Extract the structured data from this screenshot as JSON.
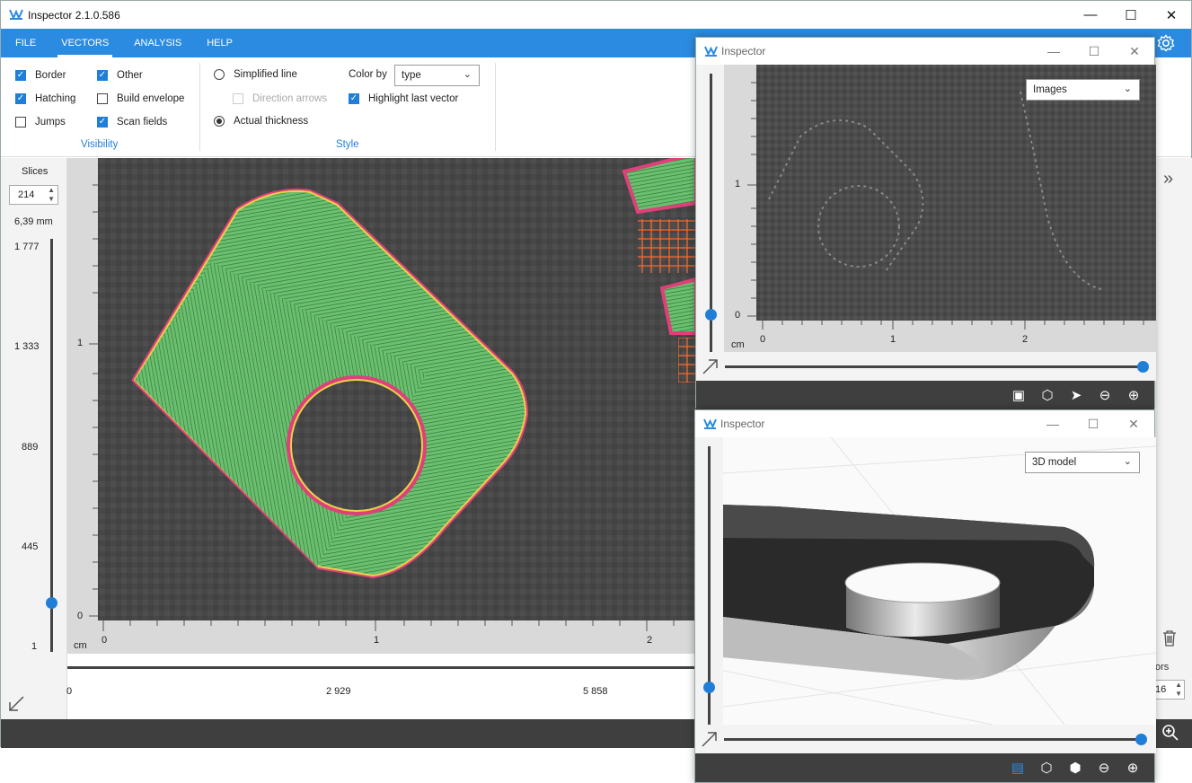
{
  "app": {
    "title": "Inspector 2.1.0.586"
  },
  "menu": {
    "items": [
      "FILE",
      "VECTORS",
      "ANALYSIS",
      "HELP"
    ],
    "active": "VECTORS"
  },
  "visibility": {
    "group_label": "Visibility",
    "border": {
      "label": "Border",
      "checked": true
    },
    "other": {
      "label": "Other",
      "checked": true
    },
    "hatching": {
      "label": "Hatching",
      "checked": true
    },
    "build_envelope": {
      "label": "Build envelope",
      "checked": false
    },
    "jumps": {
      "label": "Jumps",
      "checked": false
    },
    "scan_fields": {
      "label": "Scan fields",
      "checked": true
    }
  },
  "style": {
    "group_label": "Style",
    "simplified_line": {
      "label": "Simplified line",
      "selected": false
    },
    "direction_arrows": {
      "label": "Direction arrows",
      "enabled": false
    },
    "actual_thickness": {
      "label": "Actual thickness",
      "selected": true
    },
    "color_by_label": "Color by",
    "color_by_value": "type",
    "highlight_last_vector": {
      "label": "Highlight last vector",
      "checked": true
    }
  },
  "slices": {
    "label": "Slices",
    "value": "214",
    "height": "6,39 mm",
    "ticks": [
      "1 777",
      "1 333",
      "889",
      "445",
      "1"
    ],
    "position_fraction": 0.12
  },
  "main_view": {
    "y_ticks": [
      "1",
      "0"
    ],
    "x_ticks": [
      "0",
      "1",
      "2"
    ],
    "unit": "cm",
    "vector_axis_ticks": [
      "0",
      "2 929",
      "5 858"
    ]
  },
  "right_panel": {
    "partial_label": "ors",
    "partial_value": "16"
  },
  "window_images": {
    "title": "Inspector",
    "dropdown": "Images",
    "y_ticks": [
      "1",
      "0"
    ],
    "x_ticks": [
      "0",
      "1",
      "2"
    ],
    "unit": "cm",
    "slider_fraction": 1.0,
    "vslider_fraction": 0.12
  },
  "window_3d": {
    "title": "Inspector",
    "dropdown": "3D model",
    "slider_fraction": 1.0,
    "vslider_fraction": 0.13
  },
  "colors": {
    "accent": "#2b8be0",
    "hatch_green": "#5fb865",
    "border_magenta": "#e0407a",
    "border_yellow": "#e8d24a",
    "scan_orange": "#ff6a2a",
    "dark_bar": "#3f3f3f"
  }
}
